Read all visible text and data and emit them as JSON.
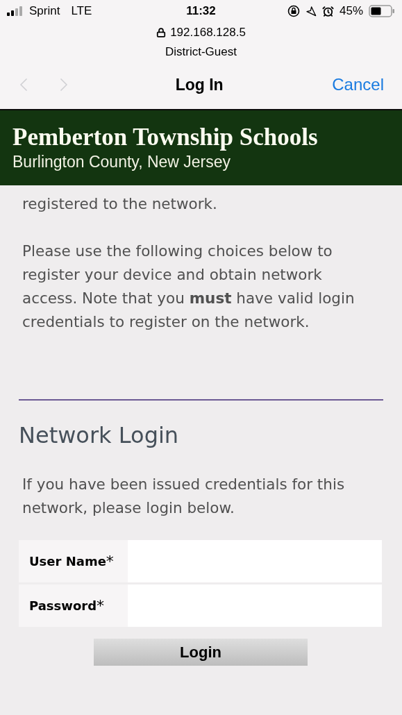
{
  "status_bar": {
    "carrier": "Sprint",
    "network": "LTE",
    "time": "11:32",
    "battery": "45%"
  },
  "address": {
    "host": "192.168.128.5",
    "network_name": "District-Guest"
  },
  "nav": {
    "back": {
      "disabled": true
    },
    "forward": {
      "disabled": true
    },
    "title": "Log In",
    "cancel": "Cancel"
  },
  "banner": {
    "title": "Pemberton Township Schools",
    "subtitle": "Burlington County, New Jersey"
  },
  "intro": [
    "registered to the network.",
    "Please use the following choices below to register your device and obtain network access. Note that you **must** have valid login credentials to register on the network."
  ],
  "login": {
    "heading": "Network Login",
    "text": "If you have been issued credentials for this network, please login below.",
    "fields": [
      {
        "label": "User Name",
        "mark": "*"
      },
      {
        "label": "Password",
        "mark": "*"
      }
    ],
    "button": "Login"
  }
}
